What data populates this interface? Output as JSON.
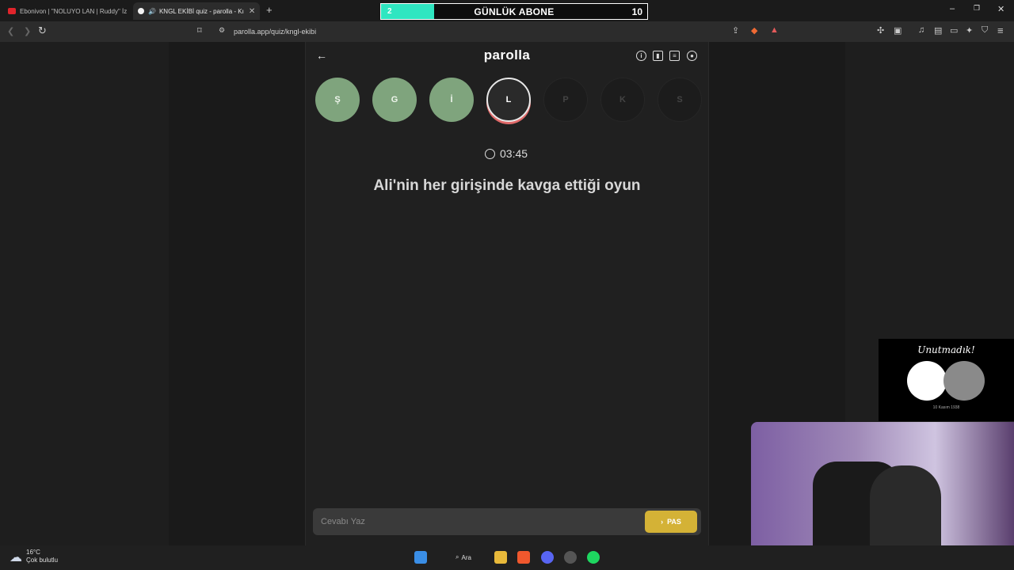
{
  "browser": {
    "tabs": [
      {
        "title": "Ebonivon | \"NOLUYO LAN | Ruddy\" İz",
        "favicon_color": "#e0242b"
      },
      {
        "title": "KNGL EKİBİ quiz - parolla - Kı",
        "favicon_color": "#f2f2f2"
      }
    ],
    "new_tab": "+",
    "url": "parolla.app/quiz/kngl-ekibi",
    "window_controls": [
      "–",
      "❐",
      "✕"
    ]
  },
  "overlay_counter": {
    "current": "2",
    "label": "GÜNLÜK ABONE",
    "goal": "10",
    "progress": 0.2,
    "fill_color": "#2fe6c1"
  },
  "app": {
    "brand": "parolla",
    "header_icons": [
      "info-icon",
      "stats-icon",
      "feedback-icon",
      "profile-icon"
    ],
    "letters": [
      {
        "char": "Ş",
        "state": "done"
      },
      {
        "char": "G",
        "state": "done"
      },
      {
        "char": "İ",
        "state": "done"
      },
      {
        "char": "L",
        "state": "current"
      },
      {
        "char": "P",
        "state": "todo"
      },
      {
        "char": "K",
        "state": "todo"
      },
      {
        "char": "S",
        "state": "todo"
      }
    ],
    "timer": "03:45",
    "question": "Ali'nin her girişinde kavga ettiği oyun",
    "answer_placeholder": "Cevabı Yaz",
    "answer_value": "",
    "pass_label": "PAS",
    "colors": {
      "done": "#7fa47d",
      "pass": "#d4b236",
      "current_ring": "#e06a6a"
    }
  },
  "poster": {
    "title": "Unutmadık!",
    "date": "10 Kasım 1938"
  },
  "taskbar": {
    "temperature": "16°C",
    "weather": "Çok bulutlu",
    "search_label": "Ara"
  }
}
